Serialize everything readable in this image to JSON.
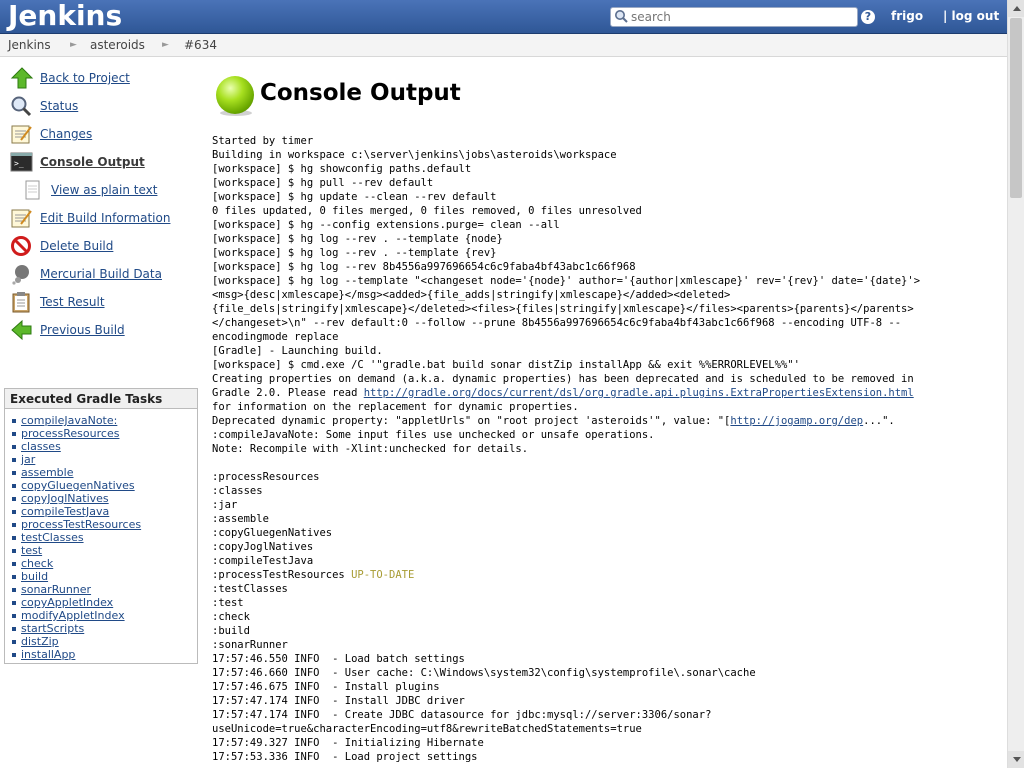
{
  "header": {
    "logo": "Jenkins",
    "search_placeholder": "search",
    "help": "?",
    "user": "frigo",
    "logout": "| log out"
  },
  "breadcrumbs": [
    "Jenkins",
    "asteroids",
    "#634"
  ],
  "tasks": [
    {
      "label": "Back to Project",
      "icon": "up-arrow-icon"
    },
    {
      "label": "Status",
      "icon": "magnifier-icon"
    },
    {
      "label": "Changes",
      "icon": "notepad-icon"
    },
    {
      "label": "Console Output",
      "icon": "terminal-icon"
    },
    {
      "label": "View as plain text",
      "icon": "document-icon"
    },
    {
      "label": "Edit Build Information",
      "icon": "notepad-icon"
    },
    {
      "label": "Delete Build",
      "icon": "no-entry-icon"
    },
    {
      "label": "Mercurial Build Data",
      "icon": "mercurial-icon"
    },
    {
      "label": "Test Result",
      "icon": "clipboard-icon"
    },
    {
      "label": "Previous Build",
      "icon": "left-arrow-icon"
    }
  ],
  "gradle": {
    "title": "Executed Gradle Tasks",
    "tasks": [
      "compileJavaNote:",
      "processResources",
      "classes",
      "jar",
      "assemble",
      "copyGluegenNatives",
      "copyJoglNatives",
      "compileTestJava",
      "processTestResources",
      "testClasses",
      "test",
      "check",
      "build",
      "sonarRunner",
      "copyAppletIndex",
      "modifyAppletIndex",
      "startScripts",
      "distZip",
      "installApp"
    ]
  },
  "main": {
    "title": "Console Output",
    "status_color": "#7ac000"
  },
  "console": {
    "lines": [
      "Started by timer",
      "Building in workspace c:\\server\\jenkins\\jobs\\asteroids\\workspace",
      "[workspace] $ hg showconfig paths.default",
      "[workspace] $ hg pull --rev default",
      "[workspace] $ hg update --clean --rev default",
      "0 files updated, 0 files merged, 0 files removed, 0 files unresolved",
      "[workspace] $ hg --config extensions.purge= clean --all",
      "[workspace] $ hg log --rev . --template {node}",
      "[workspace] $ hg log --rev . --template {rev}",
      "[workspace] $ hg log --rev 8b4556a997696654c6c9faba4bf43abc1c66f968",
      "[workspace] $ hg log --template \"<changeset node='{node}' author='{author|xmlescape}' rev='{rev}' date='{date}'>",
      "<msg>{desc|xmlescape}</msg><added>{file_adds|stringify|xmlescape}</added><deleted>",
      "{file_dels|stringify|xmlescape}</deleted><files>{files|stringify|xmlescape}</files><parents>{parents}</parents>",
      "</changeset>\\n\" --rev default:0 --follow --prune 8b4556a997696654c6c9faba4bf43abc1c66f968 --encoding UTF-8 --",
      "encodingmode replace",
      "[Gradle] - Launching build.",
      "[workspace] $ cmd.exe /C '\"gradle.bat build sonar distZip installApp && exit %%ERRORLEVEL%%\"'",
      "Creating properties on demand (a.k.a. dynamic properties) has been deprecated and is scheduled to be removed in",
      "",
      "for information on the replacement for dynamic properties.",
      "",
      ":compileJavaNote: Some input files use unchecked or unsafe operations.",
      "Note: Recompile with -Xlint:unchecked for details.",
      "",
      ":processResources",
      ":classes",
      ":jar",
      ":assemble",
      ":copyGluegenNatives",
      ":copyJoglNatives",
      ":compileTestJava",
      "",
      ":testClasses",
      ":test",
      ":check",
      ":build",
      ":sonarRunner",
      "17:57:46.550 INFO  - Load batch settings",
      "17:57:46.660 INFO  - User cache: C:\\Windows\\system32\\config\\systemprofile\\.sonar\\cache",
      "17:57:46.675 INFO  - Install plugins",
      "17:57:47.174 INFO  - Install JDBC driver",
      "17:57:47.174 INFO  - Create JDBC datasource for jdbc:mysql://server:3306/sonar?",
      "useUnicode=true&characterEncoding=utf8&rewriteBatchedStatements=true",
      "17:57:49.327 INFO  - Initializing Hibernate",
      "17:57:53.336 INFO  - Load project settings"
    ],
    "gradle_prefix": "Gradle 2.0. Please read ",
    "gradle_link": "http://gradle.org/docs/current/dsl/org.gradle.api.plugins.ExtraPropertiesExtension.html",
    "dyn_prefix": "Deprecated dynamic property: \"appletUrls\" on \"root project 'asteroids'\", value: \"[",
    "dyn_link": "http://jogamp.org/dep",
    "dyn_suffix": "...\".",
    "ptr_prefix": ":processTestResources ",
    "ptr_status": "UP-TO-DATE"
  }
}
